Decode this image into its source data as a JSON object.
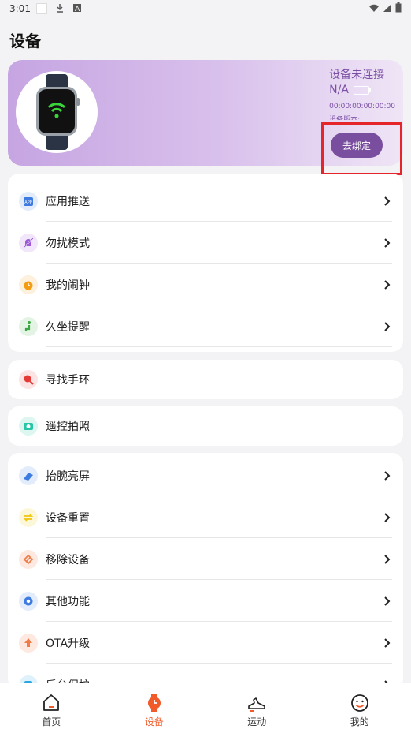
{
  "status_bar": {
    "time": "3:01"
  },
  "page": {
    "title": "设备"
  },
  "device": {
    "status": "设备未连接",
    "battery": "N/A",
    "mac": "00:00:00:00:00:00",
    "version_label": "设备版本:",
    "unbind_label": "去绑定"
  },
  "menu_group_1": [
    {
      "label": "应用推送",
      "icon": "app-push-icon",
      "color": "#3d7be0"
    },
    {
      "label": "勿扰模式",
      "icon": "do-not-disturb-icon",
      "color": "#9b59d6"
    },
    {
      "label": "我的闹钟",
      "icon": "alarm-clock-icon",
      "color": "#f39c12"
    },
    {
      "label": "久坐提醒",
      "icon": "sedentary-icon",
      "color": "#3aa842"
    }
  ],
  "menu_find": {
    "label": "寻找手环",
    "icon": "find-band-icon",
    "color": "#e53935"
  },
  "menu_camera": {
    "label": "遥控拍照",
    "icon": "camera-icon",
    "color": "#26c6a6"
  },
  "menu_group_2": [
    {
      "label": "抬腕亮屏",
      "icon": "raise-wrist-icon",
      "color": "#3d7be0"
    },
    {
      "label": "设备重置",
      "icon": "reset-icon",
      "color": "#f1c40f"
    },
    {
      "label": "移除设备",
      "icon": "remove-device-icon",
      "color": "#f07c4a"
    },
    {
      "label": "其他功能",
      "icon": "settings-icon",
      "color": "#3d7be0"
    },
    {
      "label": "OTA升级",
      "icon": "ota-upgrade-icon",
      "color": "#f07c4a"
    },
    {
      "label": "后台保护",
      "icon": "background-protect-icon",
      "color": "#2aa6e0"
    }
  ],
  "bottom_nav": [
    {
      "label": "首页",
      "icon": "home-icon"
    },
    {
      "label": "设备",
      "icon": "watch-icon",
      "active": true
    },
    {
      "label": "运动",
      "icon": "shoe-icon"
    },
    {
      "label": "我的",
      "icon": "smile-icon"
    }
  ]
}
